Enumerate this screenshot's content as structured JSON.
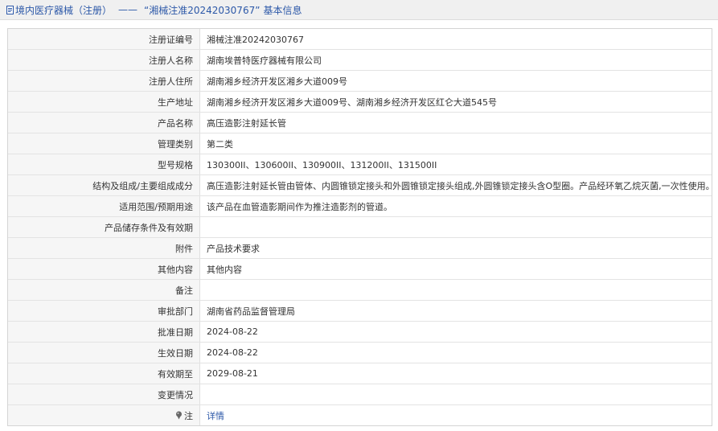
{
  "header": {
    "category": "境内医疗器械（注册）",
    "separator": "——",
    "title": "“湘械注准20242030767”",
    "suffix": "基本信息"
  },
  "rows": [
    {
      "label": "注册证编号",
      "value": "湘械注准20242030767"
    },
    {
      "label": "注册人名称",
      "value": "湖南埃普特医疗器械有限公司"
    },
    {
      "label": "注册人住所",
      "value": "湖南湘乡经济开发区湘乡大道009号"
    },
    {
      "label": "生产地址",
      "value": "湖南湘乡经济开发区湘乡大道009号、湖南湘乡经济开发区红仑大道545号"
    },
    {
      "label": "产品名称",
      "value": "高压造影注射延长管"
    },
    {
      "label": "管理类别",
      "value": "第二类"
    },
    {
      "label": "型号规格",
      "value": "130300II、130600II、130900II、131200II、131500II"
    },
    {
      "label": "结构及组成/主要组成成分",
      "value": "高压造影注射延长管由管体、内圆锥锁定接头和外圆锥锁定接头组成,外圆锥锁定接头含O型圈。产品经环氧乙烷灭菌,一次性使用。"
    },
    {
      "label": "适用范围/预期用途",
      "value": "该产品在血管造影期间作为推注造影剂的管道。"
    },
    {
      "label": "产品储存条件及有效期",
      "value": ""
    },
    {
      "label": "附件",
      "value": "产品技术要求"
    },
    {
      "label": "其他内容",
      "value": "其他内容"
    },
    {
      "label": "备注",
      "value": ""
    },
    {
      "label": "审批部门",
      "value": "湖南省药品监督管理局"
    },
    {
      "label": "批准日期",
      "value": "2024-08-22"
    },
    {
      "label": "生效日期",
      "value": "2024-08-22"
    },
    {
      "label": "有效期至",
      "value": "2029-08-21"
    },
    {
      "label": "变更情况",
      "value": ""
    }
  ],
  "note": {
    "label": "注",
    "link": "详情"
  },
  "colors": {
    "link": "#2c58a8",
    "label_bg": "#f6f6f6",
    "header_bg": "#f0f0f0"
  }
}
